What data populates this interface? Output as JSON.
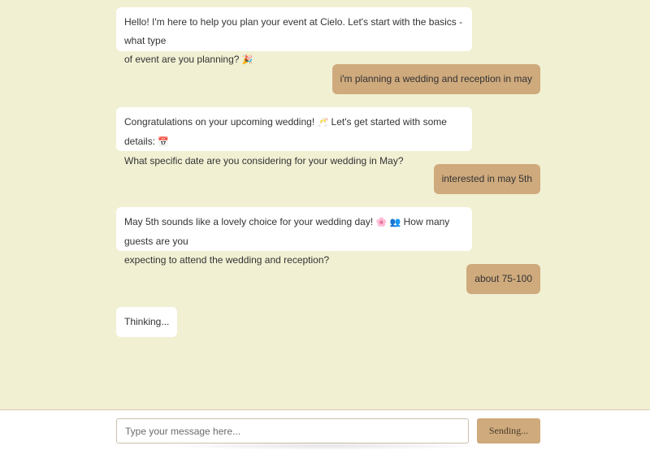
{
  "colors": {
    "background": "#f1f0d3",
    "bot_bubble": "#ffffff",
    "user_bubble": "#cfaa7d"
  },
  "messages": [
    {
      "role": "bot",
      "line1": "Hello! I'm here to help you plan your event at Cielo. Let's start with the basics - what type",
      "line2": "of event are you planning?",
      "emoji2": "🎉"
    },
    {
      "role": "user",
      "text": "i'm planning a wedding and reception in may"
    },
    {
      "role": "bot",
      "line1": "Congratulations on your upcoming wedding!",
      "emoji1a": "🥂",
      "line1b": "Let's get started with some details:",
      "emoji1b": "📅",
      "line2": "What specific date are you considering for your wedding in May?"
    },
    {
      "role": "user",
      "text": "interested in may 5th"
    },
    {
      "role": "bot",
      "line1": "May 5th sounds like a lovely choice for your wedding day!",
      "emoji1a": "🌸",
      "emoji1b": "👥",
      "line1b": "How many guests are you",
      "line2": "expecting to attend the wedding and reception?"
    },
    {
      "role": "user",
      "text": "about 75-100"
    },
    {
      "role": "bot",
      "text": "Thinking..."
    }
  ],
  "composer": {
    "placeholder": "Type your message here...",
    "send_label": "Sending..."
  }
}
